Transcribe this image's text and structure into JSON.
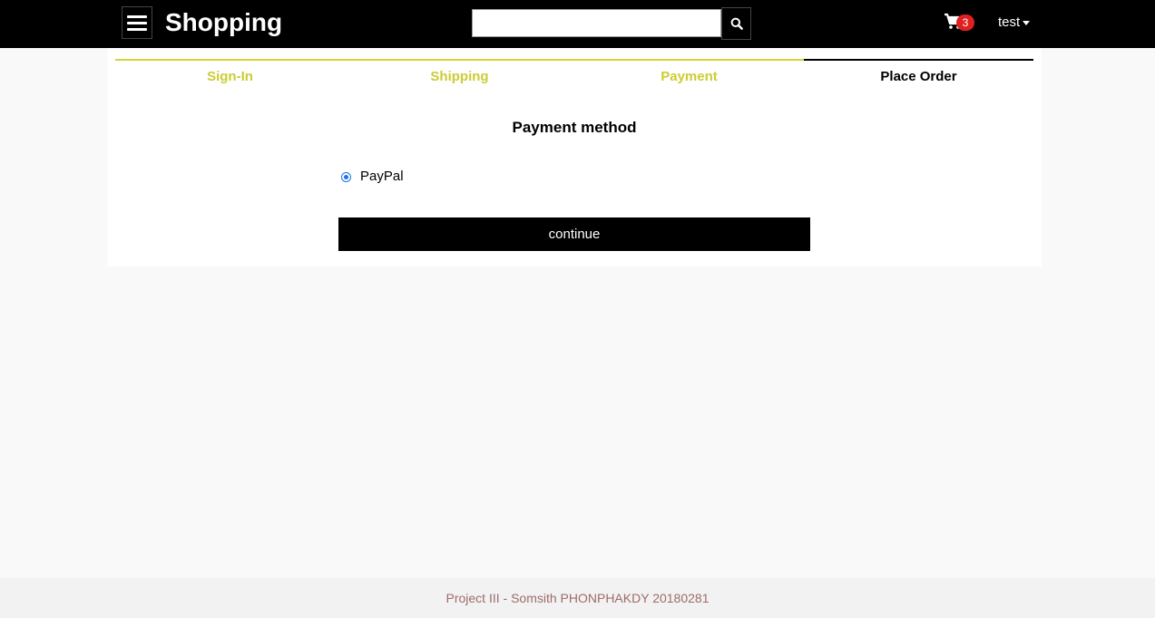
{
  "header": {
    "brand": "Shopping",
    "search": {
      "value": "",
      "placeholder": ""
    },
    "cart_count": "3",
    "user_name": "test",
    "background": "#000000"
  },
  "checkout_steps": [
    {
      "label": "Sign-In",
      "status": "completed"
    },
    {
      "label": "Shipping",
      "status": "completed"
    },
    {
      "label": "Payment",
      "status": "completed"
    },
    {
      "label": "Place Order",
      "status": "current"
    }
  ],
  "payment": {
    "title": "Payment method",
    "options": [
      {
        "label": "PayPal",
        "selected": true
      }
    ],
    "continue_label": "continue"
  },
  "footer": {
    "text": "Project III - Somsith PHONPHAKDY 20180281"
  },
  "colors": {
    "step_completed": "#cccc33",
    "accent": "#000000",
    "badge": "#e02020"
  }
}
